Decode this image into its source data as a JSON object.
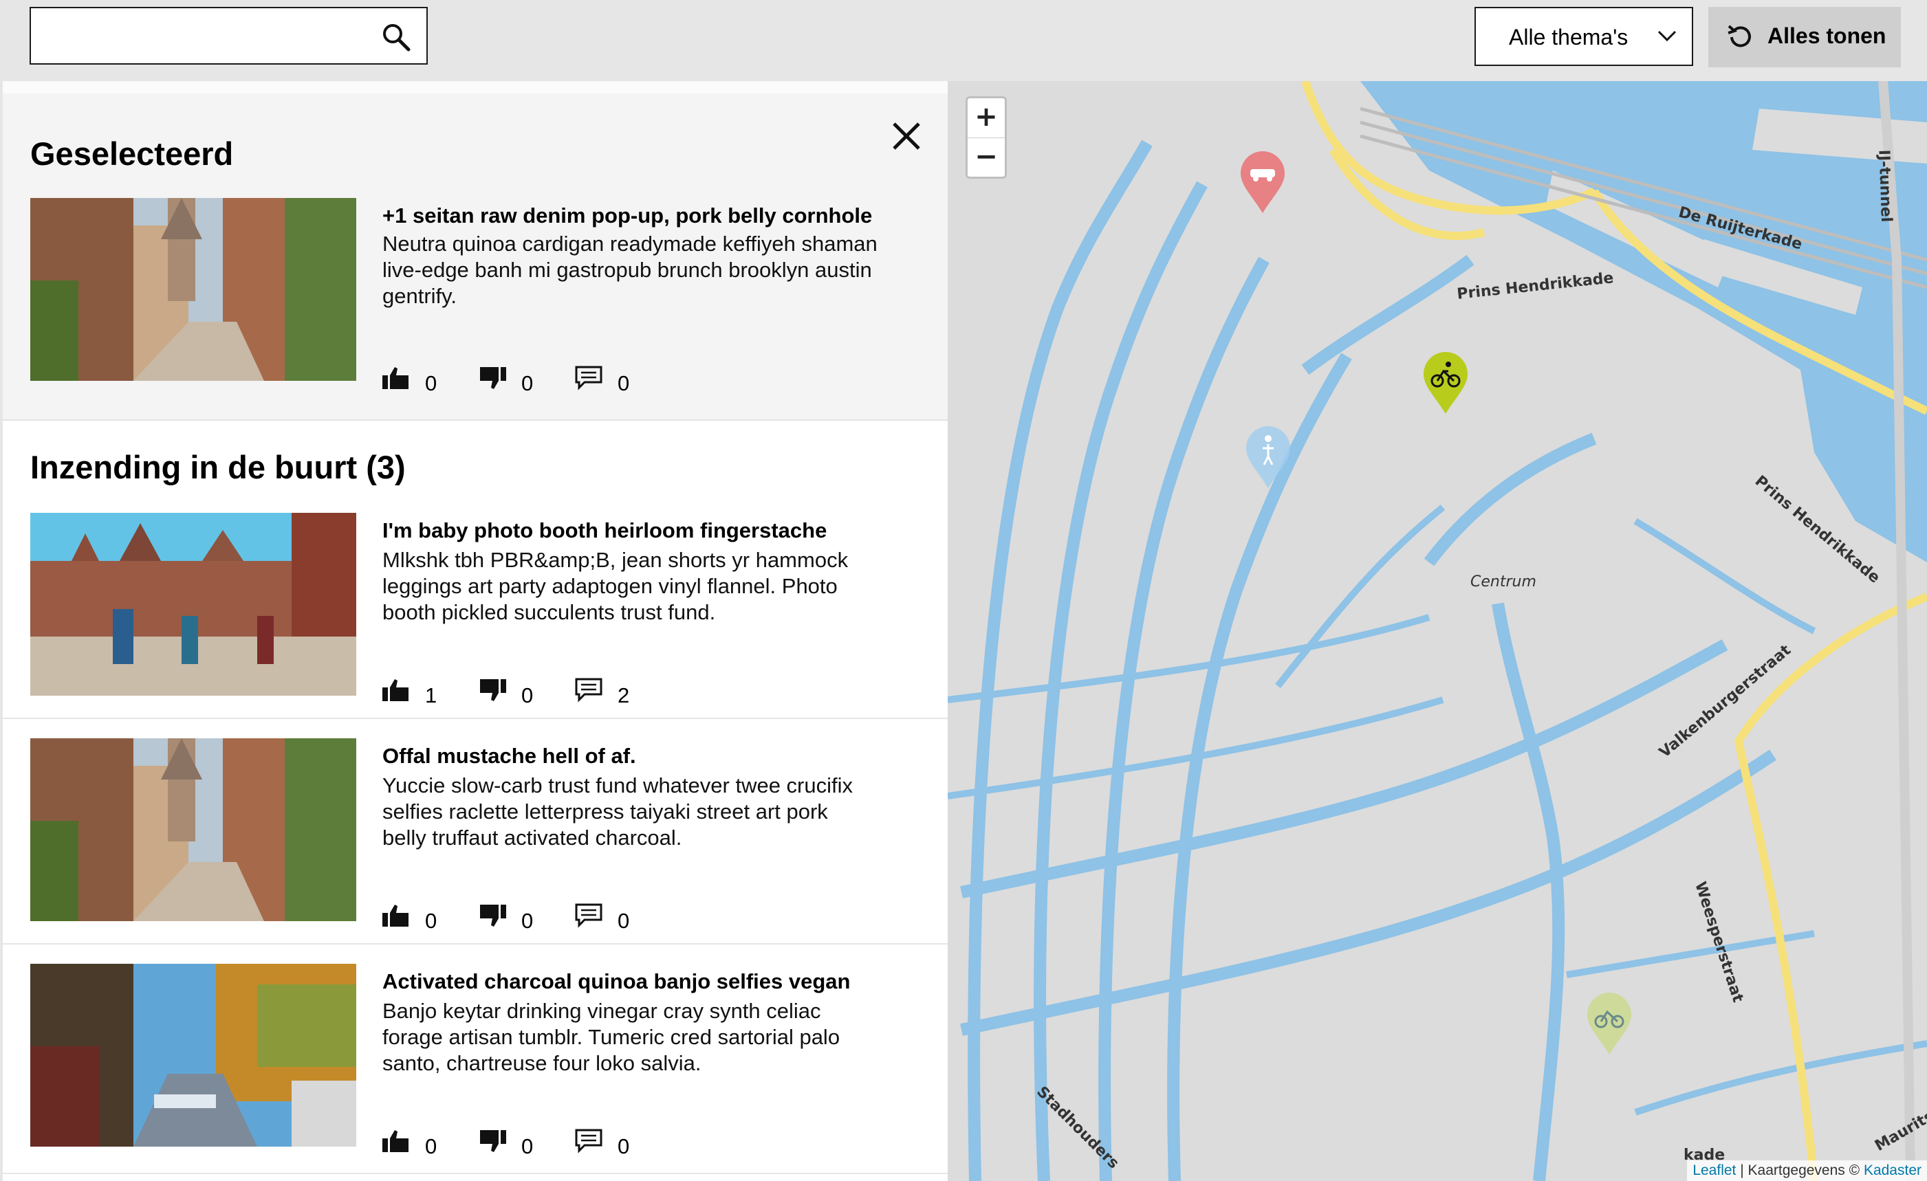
{
  "search": {
    "placeholder": "",
    "value": ""
  },
  "theme_filter": {
    "selected": "Alle thema's"
  },
  "show_all": {
    "label": "Alles tonen"
  },
  "selected_section": {
    "title": "Geselecteerd",
    "item": {
      "title": "+1 seitan raw denim pop-up, pork belly cornhole",
      "description": "Neutra quinoa cardigan readymade keffiyeh shaman live-edge banh mi gastropub brunch brooklyn austin gentrify.",
      "likes": "0",
      "dislikes": "0",
      "comments": "0"
    }
  },
  "nearby_section": {
    "title": "Inzending in de buurt (3)",
    "items": [
      {
        "title": "I'm baby photo booth heirloom fingerstache",
        "description": "Mlkshk tbh PBR&amp;B, jean shorts yr hammock leggings art party adaptogen vinyl flannel. Photo booth pickled succulents trust fund.",
        "likes": "1",
        "dislikes": "0",
        "comments": "2"
      },
      {
        "title": "Offal mustache hell of af.",
        "description": "Yuccie slow-carb trust fund whatever twee crucifix selfies raclette letterpress taiyaki street art pork belly truffaut activated charcoal.",
        "likes": "0",
        "dislikes": "0",
        "comments": "0"
      },
      {
        "title": "Activated charcoal quinoa banjo selfies vegan",
        "description": "Banjo keytar drinking vinegar cray synth celiac forage artisan tumblr. Tumeric cred sartorial palo santo, chartreuse four loko salvia.",
        "likes": "0",
        "dislikes": "0",
        "comments": "0"
      }
    ]
  },
  "map": {
    "zoom_in": "+",
    "zoom_out": "−",
    "streets": [
      "De Ruijterkade",
      "Prins Hendrikkade",
      "Prins Hendrikkade",
      "Centrum",
      "Valkenburgerstraat",
      "Weesperstraat",
      "IJ-tunnel",
      "Stadhouders",
      "Mauritskade",
      "kade"
    ],
    "attribution": {
      "leaflet": "Leaflet",
      "sep": " | Kaartgegevens © ",
      "kadaster": "Kadaster"
    },
    "markers": [
      {
        "name": "car-marker",
        "color": "#e8777a"
      },
      {
        "name": "bicycle-marker",
        "color": "#b8cc1c"
      },
      {
        "name": "pedestrian-marker",
        "color": "#9fcdf0"
      },
      {
        "name": "bicycle-marker-faded",
        "color": "#c9d98a"
      }
    ]
  },
  "colors": {
    "water": "#8ec2e6",
    "roads": "#ffffff",
    "land": "#dcdcdc",
    "main_road": "#f6e07a"
  }
}
